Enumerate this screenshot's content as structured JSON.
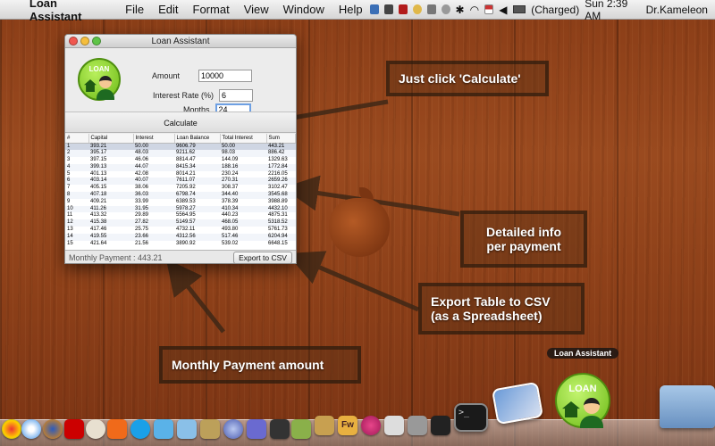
{
  "menubar": {
    "apple_glyph": "",
    "app_name": "Loan Assistant",
    "items": [
      "File",
      "Edit",
      "Format",
      "View",
      "Window",
      "Help"
    ],
    "battery_status": "(Charged)",
    "clock": "Sun 2:39 AM",
    "user": "Dr.Kameleon"
  },
  "window": {
    "title": "Loan Assistant",
    "logo_text": "LOAN",
    "amount_label": "Amount",
    "amount_value": "10000",
    "rate_label": "Interest Rate (%)",
    "rate_value": "6",
    "months_label": "Months",
    "months_value": "24",
    "calculate_label": "Calculate",
    "columns": [
      "#",
      "Capital",
      "Interest",
      "Loan Balance",
      "Total Interest",
      "Sum"
    ],
    "rows": [
      [
        "1",
        "393.21",
        "50.00",
        "9606.79",
        "50.00",
        "443.21"
      ],
      [
        "2",
        "395.17",
        "48.03",
        "9211.62",
        "98.03",
        "886.42"
      ],
      [
        "3",
        "397.15",
        "46.06",
        "8814.47",
        "144.09",
        "1329.63"
      ],
      [
        "4",
        "399.13",
        "44.07",
        "8415.34",
        "188.16",
        "1772.84"
      ],
      [
        "5",
        "401.13",
        "42.08",
        "8014.21",
        "230.24",
        "2216.05"
      ],
      [
        "6",
        "403.14",
        "40.07",
        "7611.07",
        "270.31",
        "2659.26"
      ],
      [
        "7",
        "405.15",
        "38.06",
        "7205.92",
        "308.37",
        "3102.47"
      ],
      [
        "8",
        "407.18",
        "36.03",
        "6798.74",
        "344.40",
        "3545.68"
      ],
      [
        "9",
        "409.21",
        "33.99",
        "6389.53",
        "378.39",
        "3988.89"
      ],
      [
        "10",
        "411.26",
        "31.95",
        "5978.27",
        "410.34",
        "4432.10"
      ],
      [
        "11",
        "413.32",
        "29.89",
        "5564.95",
        "440.23",
        "4875.31"
      ],
      [
        "12",
        "415.38",
        "27.82",
        "5149.57",
        "468.05",
        "5318.52"
      ],
      [
        "13",
        "417.46",
        "25.75",
        "4732.11",
        "493.80",
        "5761.73"
      ],
      [
        "14",
        "419.55",
        "23.66",
        "4312.56",
        "517.46",
        "6204.94"
      ],
      [
        "15",
        "421.64",
        "21.56",
        "3890.92",
        "539.02",
        "6648.15"
      ]
    ],
    "monthly_payment": "Monthly Payment : 443.21",
    "export_label": "Export to CSV"
  },
  "callouts": {
    "calculate": "Just click 'Calculate'",
    "detailed_1": "Detailed info",
    "detailed_2": "per payment",
    "export_1": "Export Table to CSV",
    "export_2": "(as a Spreadsheet)",
    "monthly": "Monthly Payment amount"
  },
  "dock": {
    "tooltip": "Loan Assistant",
    "loan_logo_text": "LOAN",
    "fw_icon_text": "Fw",
    "terminal_prompt": ">_"
  },
  "colors": {
    "wood": "#8a3d17",
    "callout_border": "#2b180c",
    "selection": "#cfd6e3",
    "logo_green": "#6cba16"
  }
}
